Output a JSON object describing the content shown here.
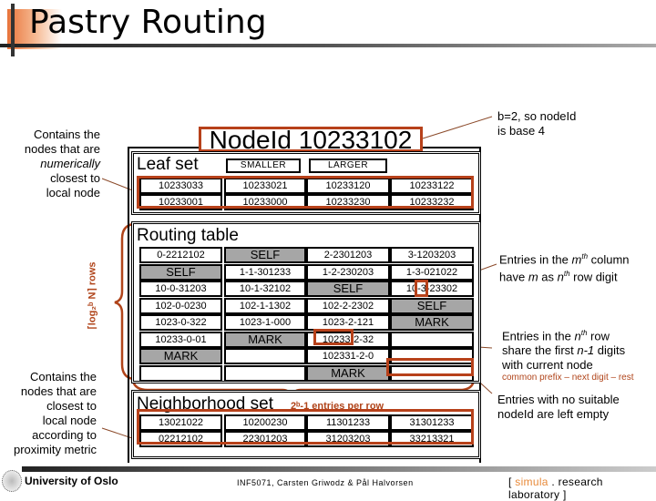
{
  "title": "Pastry Routing",
  "nodeid": "NodeId 10233102",
  "notes": {
    "base": [
      "b=2, so nodeId",
      "is base 4"
    ],
    "leaf_set": [
      "Contains the",
      "nodes that are",
      "numerically",
      "closest to",
      "local node"
    ],
    "neighborhood": [
      "Contains the",
      "nodes that are",
      "closest to",
      "local node",
      "according to",
      "proximity metric"
    ],
    "column": [
      "Entries in the ",
      "m",
      "th",
      " column",
      "have ",
      "m",
      " as ",
      "n",
      "th",
      " row digit"
    ],
    "row": [
      "Entries in the ",
      "n",
      "th",
      " row",
      "share the first ",
      "n-1",
      " digits",
      "with current node"
    ],
    "prefix_hint": "common prefix – next digit – rest",
    "empty": [
      "Entries with no suitable",
      "nodeId are left empty"
    ],
    "rows_label": "⌈log₂ᵇ N⌉ rows",
    "entries_per_row": "2ᵇ-1 entries per row"
  },
  "leaf_set": {
    "label": "Leaf set",
    "smaller": "SMALLER",
    "larger": "LARGER",
    "rows": [
      [
        "10233033",
        "10233021",
        "10233120",
        "10233122"
      ],
      [
        "10233001",
        "10233000",
        "10233230",
        "10233232"
      ]
    ]
  },
  "routing_table": {
    "label": "Routing table",
    "rows": [
      [
        {
          "t": "0-2212102"
        },
        {
          "t": "SELF",
          "g": true
        },
        {
          "t": "2-2301203"
        },
        {
          "t": "3-1203203"
        }
      ],
      [
        {
          "t": "SELF",
          "g": true
        },
        {
          "t": "1-1-301233"
        },
        {
          "t": "1-2-230203"
        },
        {
          "t": "1-3-021022"
        }
      ],
      [
        {
          "t": "10-0-31203"
        },
        {
          "t": "10-1-32102"
        },
        {
          "t": "SELF",
          "g": true
        },
        {
          "t": "10-3-23302"
        }
      ],
      [
        {
          "t": "102-0-0230"
        },
        {
          "t": "102-1-1302"
        },
        {
          "t": "102-2-2302"
        },
        {
          "t": "SELF",
          "g": true
        }
      ],
      [
        {
          "t": "1023-0-322"
        },
        {
          "t": "1023-1-000"
        },
        {
          "t": "1023-2-121"
        },
        {
          "t": "MARK",
          "g": true
        }
      ],
      [
        {
          "t": "10233-0-01"
        },
        {
          "t": "MARK",
          "g": true
        },
        {
          "t": "10233-2-32"
        },
        {
          "t": ""
        }
      ],
      [
        {
          "t": "MARK",
          "g": true
        },
        {
          "t": ""
        },
        {
          "t": "102331-2-0"
        },
        {
          "t": ""
        }
      ],
      [
        {
          "t": ""
        },
        {
          "t": ""
        },
        {
          "t": "MARK",
          "g": true
        },
        {
          "t": ""
        }
      ]
    ]
  },
  "neighborhood_set": {
    "label": "Neighborhood set",
    "rows": [
      [
        "13021022",
        "10200230",
        "11301233",
        "31301233"
      ],
      [
        "02212102",
        "22301203",
        "31203203",
        "33213321"
      ]
    ]
  },
  "footer": {
    "university": "University of Oslo",
    "course": "INF5071, Carsten Griwodz & Pål Halvorsen",
    "lab_open": "[ ",
    "lab_accent": "simula",
    "lab_rest": " . research laboratory ]"
  },
  "colors": {
    "accent_red": "#b7411a",
    "self_gray": "#a6a6a6"
  }
}
